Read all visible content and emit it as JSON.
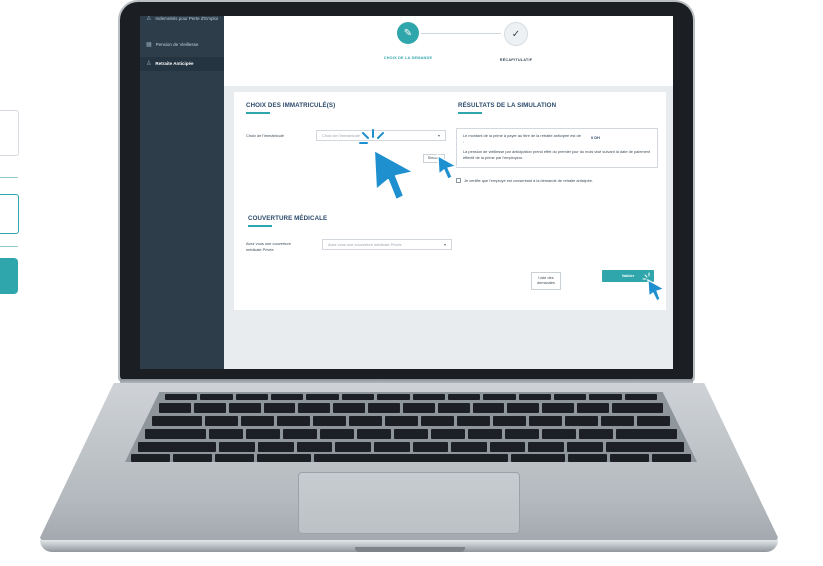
{
  "sidebar": {
    "items": [
      {
        "label": "Indemnités pour Perte d'Emploi",
        "icon": "person-icon",
        "active": false
      },
      {
        "label": "Pension de Vieillesse",
        "icon": "grid-icon",
        "active": false
      },
      {
        "label": "Retraite Anticipée",
        "icon": "person-icon",
        "active": true
      }
    ]
  },
  "steps": [
    {
      "label": "CHOIX DE LA DEMANDE",
      "icon": "pencil-icon",
      "state": "active"
    },
    {
      "label": "RÉCAPITULATIF",
      "icon": "check-icon",
      "state": "pending"
    }
  ],
  "left_section": {
    "title": "CHOIX DES IMMATRICULÉ(S)",
    "field_label": "Choix de l'immatriculé",
    "select_placeholder": "Choix de l'immatriculé",
    "button_label": "Simuler"
  },
  "right_section": {
    "title": "RÉSULTATS DE LA SIMULATION",
    "result_text": "Le montant de la prime à payer au titre de la retraite anticipée est de :",
    "result_value": "0 DH",
    "note": "La pension de vieillesse par anticipation prend effet du premier jour du mois visé suivant la date de paiement effectif de la prime par l'employeur.",
    "checkbox_label": "Je certifie que l'employé est consentant à la demande de retraite anticipée."
  },
  "medical_section": {
    "title": "COUVERTURE MÉDICALE",
    "field_label": "Avez vous une couverture médicale Privée",
    "select_placeholder": "Avez vous une couverture médicale Privée"
  },
  "actions": {
    "list_label": "Liste des demandes",
    "validate_label": "Valider"
  },
  "colors": {
    "accent": "#2fa6ab",
    "sidebar": "#2d3d4a",
    "title": "#2c4a6b",
    "cursor": "#1e8fcf"
  }
}
